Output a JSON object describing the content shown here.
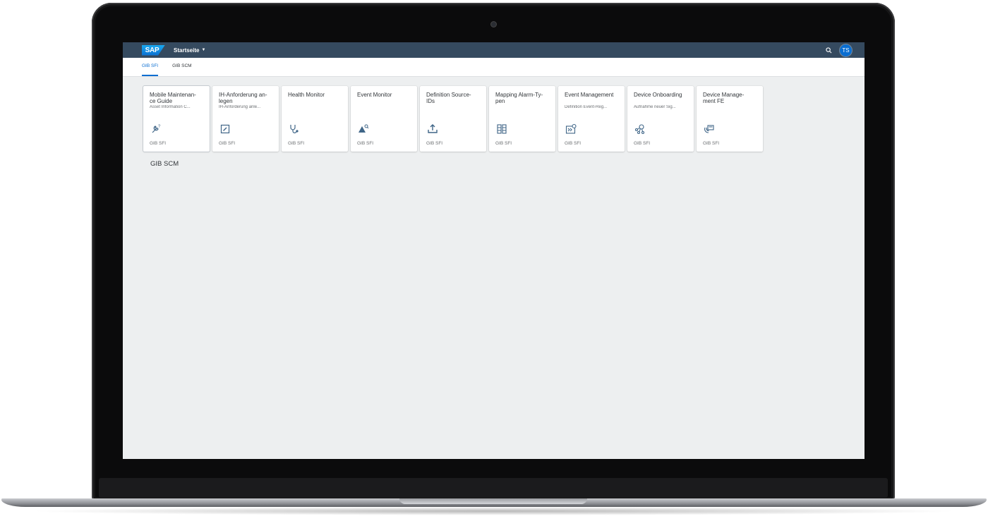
{
  "shell": {
    "logo_text": "SAP",
    "home_title": "Startseite",
    "avatar_initials": "TS",
    "colors": {
      "shellbar": "#354a5f",
      "accent": "#0a6ed1",
      "background": "#edeff0"
    }
  },
  "tabs": [
    {
      "label": "GIB SFI",
      "active": true
    },
    {
      "label": "GIB SCM",
      "active": false
    }
  ],
  "tiles": [
    {
      "title": "Mobile Maintenan-\nce Guide",
      "subtitle": "Asset Information C...",
      "icon": "wrench-question-icon",
      "footer": "GIB SFI"
    },
    {
      "title": "IH-Anforderung an-\nlegen",
      "subtitle": "IH-Anforderung anle...",
      "icon": "edit-square-icon",
      "footer": "GIB SFI"
    },
    {
      "title": "Health Monitor",
      "subtitle": "",
      "icon": "stethoscope-icon",
      "footer": "GIB SFI"
    },
    {
      "title": "Event Monitor",
      "subtitle": "",
      "icon": "warning-search-icon",
      "footer": "GIB SFI"
    },
    {
      "title": "Definition Source-\nIDs",
      "subtitle": "",
      "icon": "upload-icon",
      "footer": "GIB SFI"
    },
    {
      "title": "Mapping Alarm-Ty-\npen",
      "subtitle": "",
      "icon": "mapping-table-icon",
      "footer": "GIB SFI"
    },
    {
      "title": "Event Management",
      "subtitle": "Definition Event-Reg...",
      "icon": "process-settings-icon",
      "footer": "GIB SFI"
    },
    {
      "title": "Device Onboarding",
      "subtitle": "Aufnahme neuer Sig...",
      "icon": "network-globe-icon",
      "footer": "GIB SFI"
    },
    {
      "title": "Device Manage-\nment FE",
      "subtitle": "",
      "icon": "device-management-icon",
      "footer": "GIB SFI"
    }
  ],
  "groups": [
    {
      "title": "GIB SCM"
    }
  ]
}
